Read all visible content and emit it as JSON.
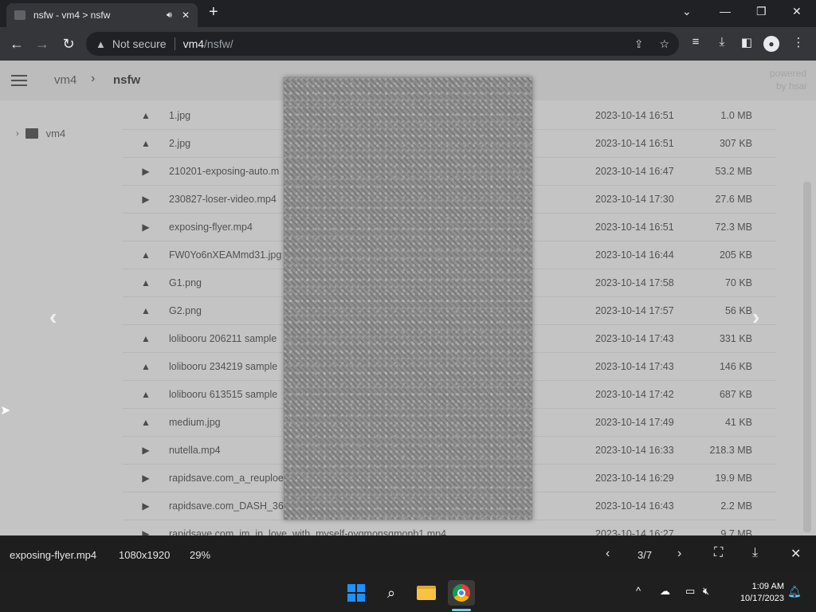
{
  "browser": {
    "tab_title": "nsfw - vm4 > nsfw",
    "security": "Not secure",
    "url_host": "vm4",
    "url_path": "/nsfw/"
  },
  "header": {
    "crumbs": [
      "vm4",
      "nsfw"
    ],
    "powered_1": "powered",
    "powered_2": "by hsai"
  },
  "sidebar": {
    "tree_root": "vm4"
  },
  "files": [
    {
      "icon": "image-icon",
      "name": "1.jpg",
      "date": "2023-10-14 16:51",
      "size": "1.0 MB"
    },
    {
      "icon": "image-icon",
      "name": "2.jpg",
      "date": "2023-10-14 16:51",
      "size": "307 KB"
    },
    {
      "icon": "video-icon",
      "name": "210201-exposing-auto.m",
      "date": "2023-10-14 16:47",
      "size": "53.2 MB"
    },
    {
      "icon": "video-icon",
      "name": "230827-loser-video.mp4",
      "date": "2023-10-14 17:30",
      "size": "27.6 MB"
    },
    {
      "icon": "video-icon",
      "name": "exposing-flyer.mp4",
      "date": "2023-10-14 16:51",
      "size": "72.3 MB"
    },
    {
      "icon": "image-icon",
      "name": "FW0Yo6nXEAMmd31.jpg",
      "date": "2023-10-14 16:44",
      "size": "205 KB"
    },
    {
      "icon": "image-icon",
      "name": "G1.png",
      "date": "2023-10-14 17:58",
      "size": "70 KB"
    },
    {
      "icon": "image-icon",
      "name": "G2.png",
      "date": "2023-10-14 17:57",
      "size": "56 KB"
    },
    {
      "icon": "image-icon",
      "name": "lolibooru 206211 sample",
      "date": "2023-10-14 17:43",
      "size": "331 KB"
    },
    {
      "icon": "image-icon",
      "name": "lolibooru 234219 sample",
      "date": "2023-10-14 17:43",
      "size": "146 KB"
    },
    {
      "icon": "image-icon",
      "name": "lolibooru 613515 sample",
      "date": "2023-10-14 17:42",
      "size": "687 KB"
    },
    {
      "icon": "image-icon",
      "name": "medium.jpg",
      "date": "2023-10-14 17:49",
      "size": "41 KB"
    },
    {
      "icon": "video-icon",
      "name": "nutella.mp4",
      "date": "2023-10-14 16:33",
      "size": "218.3 MB"
    },
    {
      "icon": "video-icon",
      "name": "rapidsave.com_a_reuploefnb1....",
      "date": "2023-10-14 16:29",
      "size": "19.9 MB"
    },
    {
      "icon": "video-icon",
      "name": "rapidsave.com_DASH_36",
      "date": "2023-10-14 16:43",
      "size": "2.2 MB"
    },
    {
      "icon": "video-icon",
      "name": "rapidsave.com_im_in_love_with_myself-oygmonsqmonb1.mp4",
      "date": "2023-10-14 16:27",
      "size": "9.7 MB"
    }
  ],
  "viewer": {
    "filename": "exposing-flyer.mp4",
    "dimensions": "1080x1920",
    "zoom": "29%",
    "counter": "3/7"
  },
  "taskbar": {
    "time": "1:09 AM",
    "date": "10/17/2023"
  },
  "colors": {
    "windows_blue": "#1e90ff",
    "chrome_red": "#db4437"
  }
}
